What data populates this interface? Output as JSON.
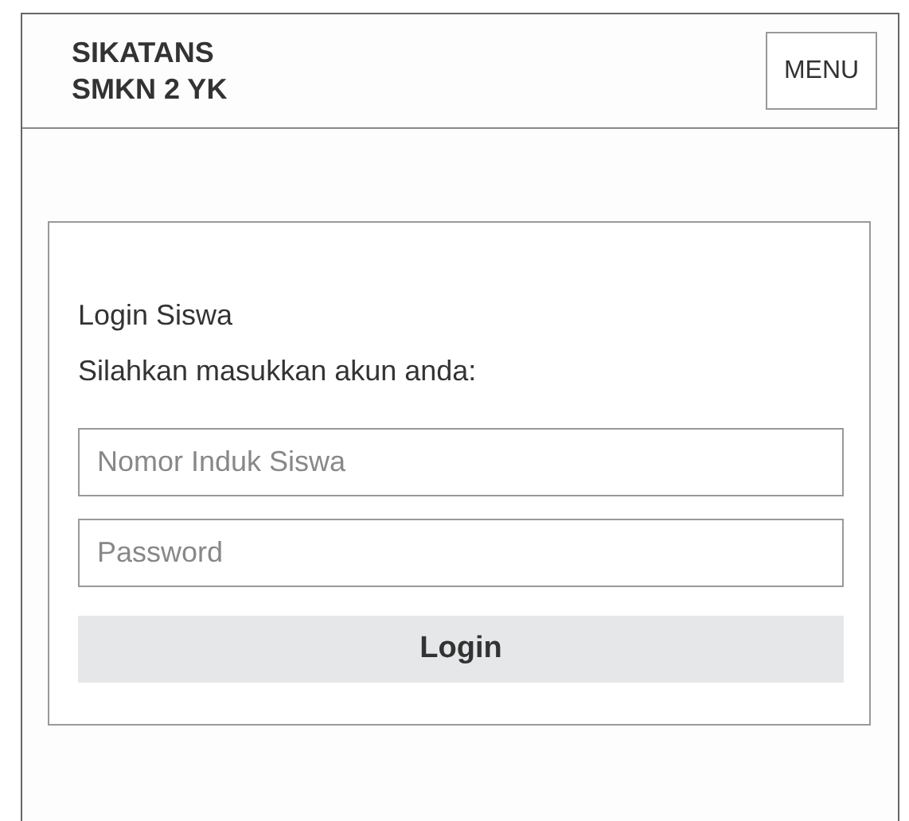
{
  "header": {
    "brand_lines": [
      "SIKATANS",
      "SMKN 2 YK"
    ],
    "menu_button": "MENU"
  },
  "login_card": {
    "title": "Login Siswa",
    "instruction": "Silahkan masukkan akun anda:",
    "fields": [
      {
        "placeholder": "Nomor Induk Siswa"
      },
      {
        "placeholder": "Password"
      }
    ],
    "submit_button": "Login"
  }
}
